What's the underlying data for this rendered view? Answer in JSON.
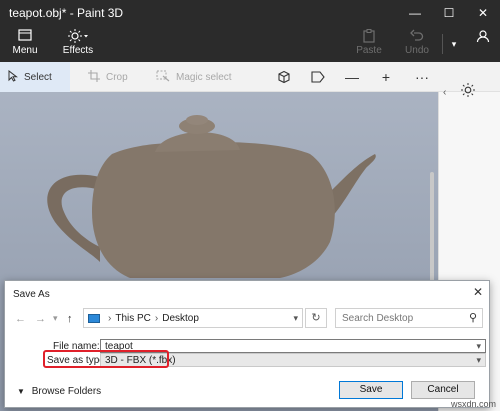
{
  "app": {
    "title": "teapot.obj* - Paint 3D"
  },
  "window_controls": {
    "minimize": "—",
    "maximize": "☐",
    "close": "✕"
  },
  "ribbon": {
    "menu_label": "Menu",
    "effects_label": "Effects",
    "paste_label": "Paste",
    "undo_label": "Undo"
  },
  "toolbar": {
    "select_label": "Select",
    "crop_label": "Crop",
    "magic_select_label": "Magic select"
  },
  "dialog": {
    "title": "Save As",
    "path": [
      "This PC",
      "Desktop"
    ],
    "search_placeholder": "Search Desktop",
    "file_name_label": "File name:",
    "file_name_value": "teapot",
    "save_type_label": "Save as type:",
    "save_type_value": "3D - FBX (*.fbx)",
    "browse_folders_label": "Browse Folders",
    "save_button": "Save",
    "cancel_button": "Cancel"
  },
  "watermark": "wsxdn.com",
  "colors": {
    "ribbon_bg": "#2b2b2b",
    "accent": "#0078d7",
    "highlight_box": "#e0202a",
    "teapot": "#7f7266"
  }
}
